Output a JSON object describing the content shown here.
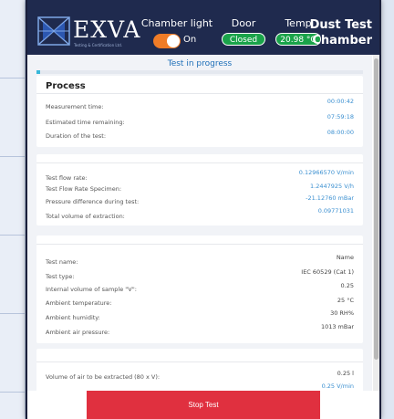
{
  "header": {
    "brand": "EXVA",
    "brand_sub": "Testing & Certification Ltd.",
    "chamber_light_label": "Chamber light",
    "chamber_light_state": "On",
    "door_label": "Door",
    "door_state": "Closed",
    "temp_label": "Temp",
    "temp_value": "20.98 °C",
    "title_line1": "Dust Test",
    "title_line2": "Chamber",
    "colors": {
      "header_bg": "#1f2a4e",
      "toggle": "#f07c27",
      "pill": "#1aa34a"
    }
  },
  "status": {
    "text": "Test in progress",
    "progress_fraction": 0.01
  },
  "process": {
    "title": "Process",
    "rows": [
      {
        "label": "Measurement time:",
        "value": "00:00:42"
      },
      {
        "label": "Estimated time remaining:",
        "value": "07:59:18"
      },
      {
        "label": "Duration of the test:",
        "value": "08:00:00"
      }
    ]
  },
  "flow": {
    "rows": [
      {
        "label": "Test flow rate:",
        "value": "0.12966570 V/min"
      },
      {
        "label": "Test Flow Rate Specimen:",
        "value": "1.2447925 V/h"
      },
      {
        "label": "Pressure difference during test:",
        "value": "-21.12760 mBar"
      },
      {
        "label": "Total volume of extraction:",
        "value": "0.09771031"
      }
    ]
  },
  "params": {
    "rows": [
      {
        "label": "Test name:",
        "value": "Name"
      },
      {
        "label": "Test type:",
        "value": "IEC 60529 (Cat 1)"
      },
      {
        "label": "Internal volume of sample \"V\":",
        "value": "0.25"
      },
      {
        "label": "Ambient temperature:",
        "value": "25 °C"
      },
      {
        "label": "Ambient humidity:",
        "value": "30 RH%"
      },
      {
        "label": "Ambient air pressure:",
        "value": "1013 mBar"
      }
    ]
  },
  "extract": {
    "rows": [
      {
        "label": "Volume of air to be extracted (80 x V):",
        "value": "0.25 l"
      },
      {
        "label": "",
        "value": "0.25 V/min"
      }
    ]
  },
  "footer": {
    "stop_label": "Stop Test",
    "stop_color": "#e0303f"
  }
}
